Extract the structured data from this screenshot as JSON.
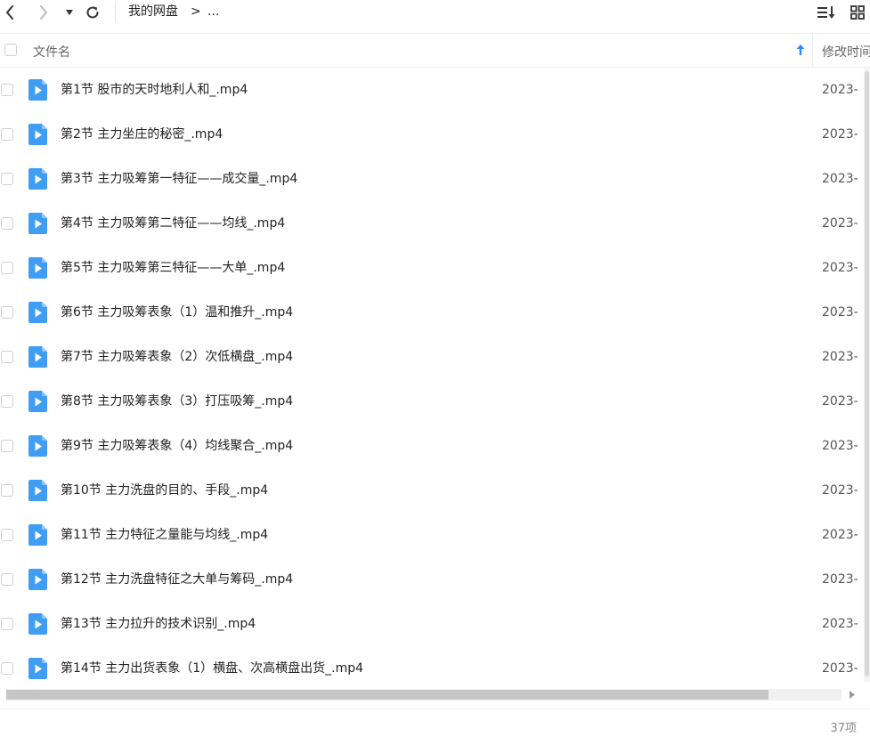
{
  "toolbar": {
    "breadcrumb_root": "我的网盘",
    "breadcrumb_sep": ">",
    "breadcrumb_more": "..."
  },
  "header": {
    "col_name": "文件名",
    "col_time": "修改时间"
  },
  "colors": {
    "accent": "#2f8cf4",
    "file_icon": "#3f9df3"
  },
  "files": [
    {
      "name": "第1节 股市的天时地利人和_.mp4",
      "time": "2023-"
    },
    {
      "name": "第2节 主力坐庄的秘密_.mp4",
      "time": "2023-"
    },
    {
      "name": "第3节 主力吸筹第一特征——成交量_.mp4",
      "time": "2023-"
    },
    {
      "name": "第4节 主力吸筹第二特征——均线_.mp4",
      "time": "2023-"
    },
    {
      "name": "第5节 主力吸筹第三特征——大单_.mp4",
      "time": "2023-"
    },
    {
      "name": "第6节 主力吸筹表象（1）温和推升_.mp4",
      "time": "2023-"
    },
    {
      "name": "第7节 主力吸筹表象（2）次低横盘_.mp4",
      "time": "2023-"
    },
    {
      "name": "第8节 主力吸筹表象（3）打压吸筹_.mp4",
      "time": "2023-"
    },
    {
      "name": "第9节 主力吸筹表象（4）均线聚合_.mp4",
      "time": "2023-"
    },
    {
      "name": "第10节 主力洗盘的目的、手段_.mp4",
      "time": "2023-"
    },
    {
      "name": "第11节 主力特征之量能与均线_.mp4",
      "time": "2023-"
    },
    {
      "name": "第12节 主力洗盘特征之大单与筹码_.mp4",
      "time": "2023-"
    },
    {
      "name": "第13节 主力拉升的技术识别_.mp4",
      "time": "2023-"
    },
    {
      "name": "第14节 主力出货表象（1）横盘、次高横盘出货_.mp4",
      "time": "2023-"
    }
  ],
  "footer": {
    "count": "37项"
  }
}
